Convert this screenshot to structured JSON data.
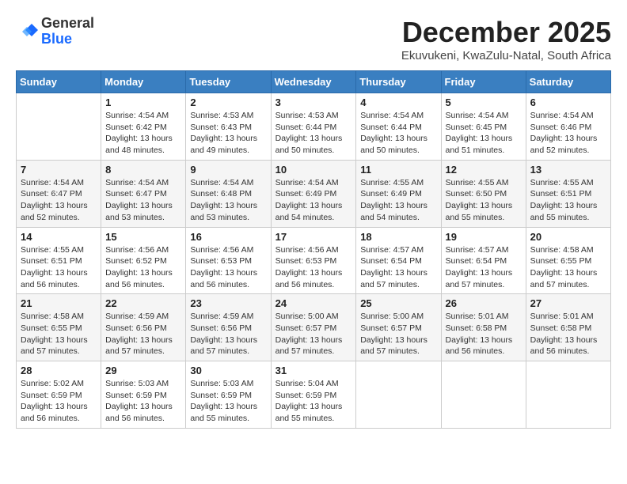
{
  "logo": {
    "general": "General",
    "blue": "Blue"
  },
  "title": "December 2025",
  "location": "Ekuvukeni, KwaZulu-Natal, South Africa",
  "days_of_week": [
    "Sunday",
    "Monday",
    "Tuesday",
    "Wednesday",
    "Thursday",
    "Friday",
    "Saturday"
  ],
  "weeks": [
    [
      {
        "day": "",
        "info": ""
      },
      {
        "day": "1",
        "info": "Sunrise: 4:54 AM\nSunset: 6:42 PM\nDaylight: 13 hours\nand 48 minutes."
      },
      {
        "day": "2",
        "info": "Sunrise: 4:53 AM\nSunset: 6:43 PM\nDaylight: 13 hours\nand 49 minutes."
      },
      {
        "day": "3",
        "info": "Sunrise: 4:53 AM\nSunset: 6:44 PM\nDaylight: 13 hours\nand 50 minutes."
      },
      {
        "day": "4",
        "info": "Sunrise: 4:54 AM\nSunset: 6:44 PM\nDaylight: 13 hours\nand 50 minutes."
      },
      {
        "day": "5",
        "info": "Sunrise: 4:54 AM\nSunset: 6:45 PM\nDaylight: 13 hours\nand 51 minutes."
      },
      {
        "day": "6",
        "info": "Sunrise: 4:54 AM\nSunset: 6:46 PM\nDaylight: 13 hours\nand 52 minutes."
      }
    ],
    [
      {
        "day": "7",
        "info": "Sunrise: 4:54 AM\nSunset: 6:47 PM\nDaylight: 13 hours\nand 52 minutes."
      },
      {
        "day": "8",
        "info": "Sunrise: 4:54 AM\nSunset: 6:47 PM\nDaylight: 13 hours\nand 53 minutes."
      },
      {
        "day": "9",
        "info": "Sunrise: 4:54 AM\nSunset: 6:48 PM\nDaylight: 13 hours\nand 53 minutes."
      },
      {
        "day": "10",
        "info": "Sunrise: 4:54 AM\nSunset: 6:49 PM\nDaylight: 13 hours\nand 54 minutes."
      },
      {
        "day": "11",
        "info": "Sunrise: 4:55 AM\nSunset: 6:49 PM\nDaylight: 13 hours\nand 54 minutes."
      },
      {
        "day": "12",
        "info": "Sunrise: 4:55 AM\nSunset: 6:50 PM\nDaylight: 13 hours\nand 55 minutes."
      },
      {
        "day": "13",
        "info": "Sunrise: 4:55 AM\nSunset: 6:51 PM\nDaylight: 13 hours\nand 55 minutes."
      }
    ],
    [
      {
        "day": "14",
        "info": "Sunrise: 4:55 AM\nSunset: 6:51 PM\nDaylight: 13 hours\nand 56 minutes."
      },
      {
        "day": "15",
        "info": "Sunrise: 4:56 AM\nSunset: 6:52 PM\nDaylight: 13 hours\nand 56 minutes."
      },
      {
        "day": "16",
        "info": "Sunrise: 4:56 AM\nSunset: 6:53 PM\nDaylight: 13 hours\nand 56 minutes."
      },
      {
        "day": "17",
        "info": "Sunrise: 4:56 AM\nSunset: 6:53 PM\nDaylight: 13 hours\nand 56 minutes."
      },
      {
        "day": "18",
        "info": "Sunrise: 4:57 AM\nSunset: 6:54 PM\nDaylight: 13 hours\nand 57 minutes."
      },
      {
        "day": "19",
        "info": "Sunrise: 4:57 AM\nSunset: 6:54 PM\nDaylight: 13 hours\nand 57 minutes."
      },
      {
        "day": "20",
        "info": "Sunrise: 4:58 AM\nSunset: 6:55 PM\nDaylight: 13 hours\nand 57 minutes."
      }
    ],
    [
      {
        "day": "21",
        "info": "Sunrise: 4:58 AM\nSunset: 6:55 PM\nDaylight: 13 hours\nand 57 minutes."
      },
      {
        "day": "22",
        "info": "Sunrise: 4:59 AM\nSunset: 6:56 PM\nDaylight: 13 hours\nand 57 minutes."
      },
      {
        "day": "23",
        "info": "Sunrise: 4:59 AM\nSunset: 6:56 PM\nDaylight: 13 hours\nand 57 minutes."
      },
      {
        "day": "24",
        "info": "Sunrise: 5:00 AM\nSunset: 6:57 PM\nDaylight: 13 hours\nand 57 minutes."
      },
      {
        "day": "25",
        "info": "Sunrise: 5:00 AM\nSunset: 6:57 PM\nDaylight: 13 hours\nand 57 minutes."
      },
      {
        "day": "26",
        "info": "Sunrise: 5:01 AM\nSunset: 6:58 PM\nDaylight: 13 hours\nand 56 minutes."
      },
      {
        "day": "27",
        "info": "Sunrise: 5:01 AM\nSunset: 6:58 PM\nDaylight: 13 hours\nand 56 minutes."
      }
    ],
    [
      {
        "day": "28",
        "info": "Sunrise: 5:02 AM\nSunset: 6:59 PM\nDaylight: 13 hours\nand 56 minutes."
      },
      {
        "day": "29",
        "info": "Sunrise: 5:03 AM\nSunset: 6:59 PM\nDaylight: 13 hours\nand 56 minutes."
      },
      {
        "day": "30",
        "info": "Sunrise: 5:03 AM\nSunset: 6:59 PM\nDaylight: 13 hours\nand 55 minutes."
      },
      {
        "day": "31",
        "info": "Sunrise: 5:04 AM\nSunset: 6:59 PM\nDaylight: 13 hours\nand 55 minutes."
      },
      {
        "day": "",
        "info": ""
      },
      {
        "day": "",
        "info": ""
      },
      {
        "day": "",
        "info": ""
      }
    ]
  ]
}
